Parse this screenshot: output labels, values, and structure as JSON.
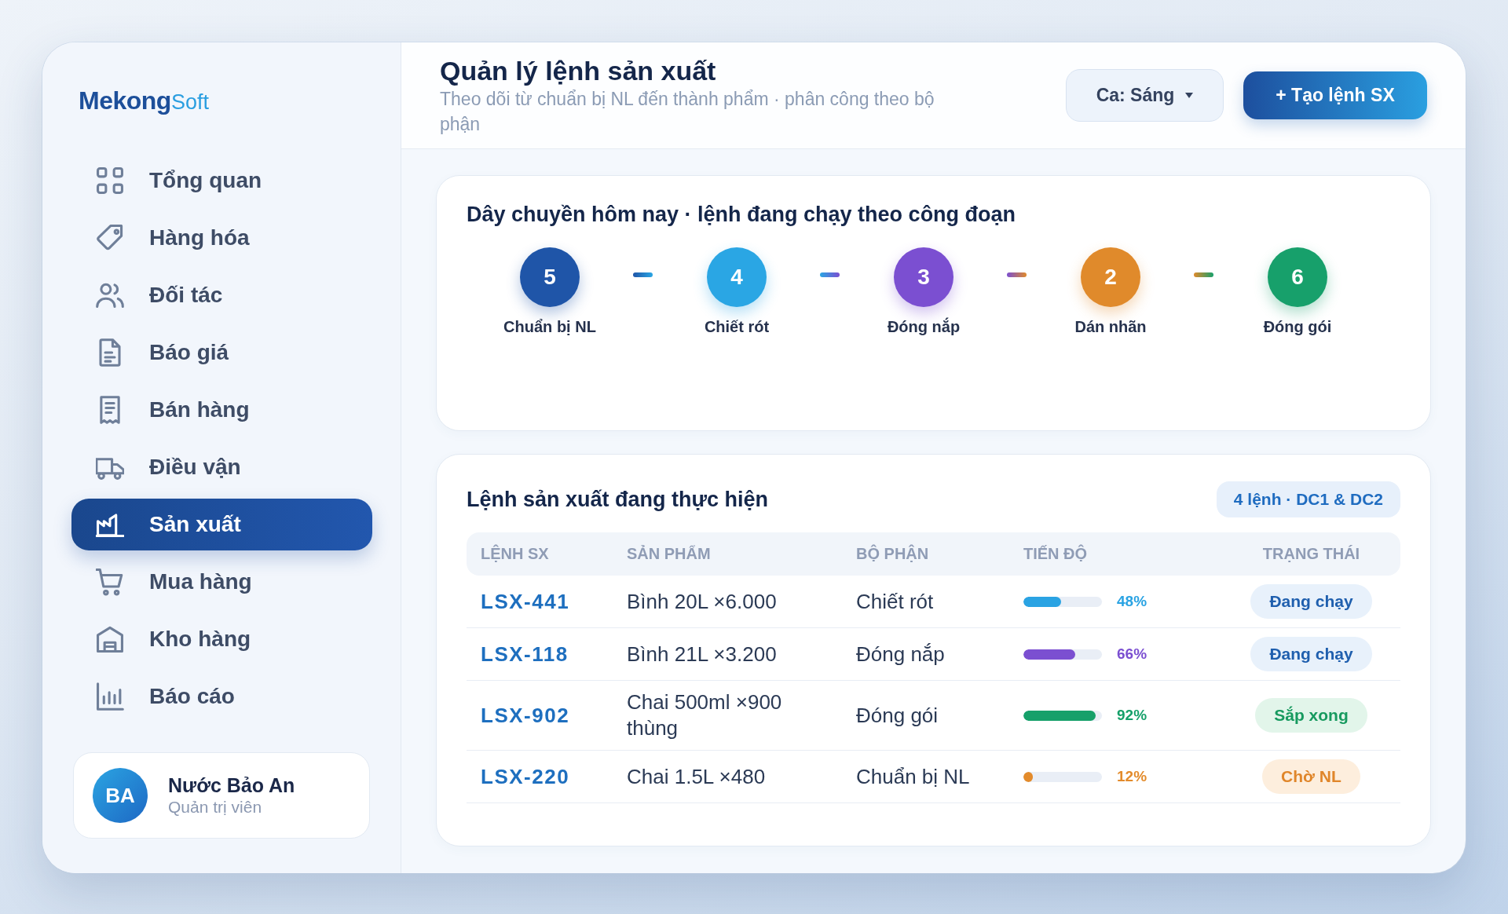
{
  "sidebar": {
    "logo": {
      "primary": "Mekong",
      "secondary": "Soft"
    },
    "items": [
      {
        "label": "Tổng quan",
        "selected": false
      },
      {
        "label": "Hàng hóa",
        "selected": false
      },
      {
        "label": "Đối tác",
        "selected": false
      },
      {
        "label": "Báo giá",
        "selected": false
      },
      {
        "label": "Bán hàng",
        "selected": false
      },
      {
        "label": "Điều vận",
        "selected": false
      },
      {
        "label": "Sản xuất",
        "selected": true
      },
      {
        "label": "Mua hàng",
        "selected": false
      },
      {
        "label": "Kho hàng",
        "selected": false
      },
      {
        "label": "Báo cáo",
        "selected": false
      }
    ],
    "user": {
      "initials": "BA",
      "name": "Nước Bảo An",
      "role": "Quản trị viên"
    }
  },
  "header": {
    "title": "Quản lý lệnh sản xuất",
    "subtitle": "Theo dõi từ chuẩn bị NL đến thành phẩm · phân công theo bộ phận",
    "shift_dropdown": {
      "value": "Ca: Sáng"
    },
    "create_button": {
      "label": "+ Tạo lệnh SX"
    }
  },
  "pipeline": {
    "title": "Dây chuyền hôm nay · lệnh đang chạy theo công đoạn",
    "stages": [
      {
        "count": "5",
        "label": "Chuẩn bị NL",
        "color": "#1f55a8"
      },
      {
        "count": "4",
        "label": "Chiết rót",
        "color": "#2aa6e4"
      },
      {
        "count": "3",
        "label": "Đóng nắp",
        "color": "#7b4fd1"
      },
      {
        "count": "2",
        "label": "Dán nhãn",
        "color": "#e08a2b"
      },
      {
        "count": "6",
        "label": "Đóng gói",
        "color": "#17a06b"
      }
    ]
  },
  "orders": {
    "title": "Lệnh sản xuất đang thực hiện",
    "summary": "4 lệnh · DC1 & DC2",
    "columns": [
      "LỆNH SX",
      "SẢN PHẨM",
      "BỘ PHẬN",
      "TIẾN ĐỘ",
      "TRẠNG THÁI"
    ],
    "rows": [
      {
        "id": "LSX-441",
        "product": "Bình 20L ×6.000",
        "department": "Chiết rót",
        "level": 0.48,
        "progress": "48%",
        "color": "#2aa3e3",
        "status": {
          "kind": "running",
          "label": "Đang chạy"
        }
      },
      {
        "id": "LSX-118",
        "product": "Bình 21L ×3.200",
        "department": "Đóng nắp",
        "level": 0.66,
        "progress": "66%",
        "color": "#7b4fd1",
        "status": {
          "kind": "running",
          "label": "Đang chạy"
        }
      },
      {
        "id": "LSX-902",
        "product": "Chai 500ml ×900 thùng",
        "department": "Đóng gói",
        "level": 0.92,
        "progress": "92%",
        "color": "#16a06a",
        "status": {
          "kind": "finishing",
          "label": "Sắp xong"
        }
      },
      {
        "id": "LSX-220",
        "product": "Chai 1.5L ×480",
        "department": "Chuẩn bị NL",
        "level": 0.12,
        "progress": "12%",
        "color": "#e38b2b",
        "status": {
          "kind": "waiting",
          "label": "Chờ NL"
        }
      }
    ]
  }
}
